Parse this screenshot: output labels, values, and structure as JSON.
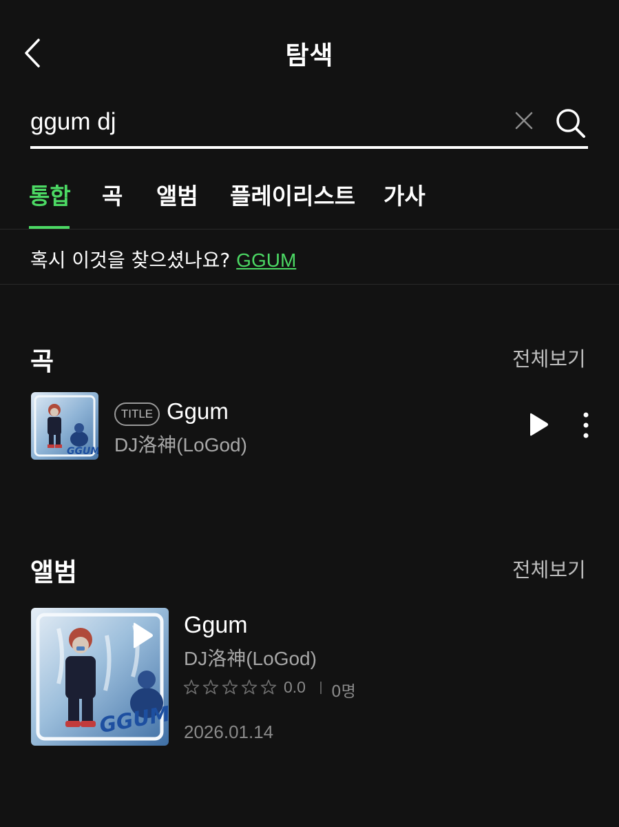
{
  "header": {
    "title": "탐색"
  },
  "search": {
    "query": "ggum dj"
  },
  "tabs": [
    {
      "label": "통합",
      "active": true
    },
    {
      "label": "곡",
      "active": false
    },
    {
      "label": "앨범",
      "active": false
    },
    {
      "label": "플레이리스트",
      "active": false
    },
    {
      "label": "가사",
      "active": false
    }
  ],
  "suggestion": {
    "prefix": "혹시 이것을 찾으셨나요?",
    "link": "GGUM"
  },
  "songs_section": {
    "title": "곡",
    "view_all": "전체보기",
    "items": [
      {
        "badge": "TITLE",
        "title": "Ggum",
        "artist": "DJ洛神(LoGod)"
      }
    ]
  },
  "albums_section": {
    "title": "앨범",
    "view_all": "전체보기",
    "items": [
      {
        "title": "Ggum",
        "artist": "DJ洛神(LoGod)",
        "rating": "0.0",
        "rating_stars": 0,
        "rating_count": "0명",
        "date": "2026.01.14"
      }
    ]
  },
  "colors": {
    "background": "#121212",
    "accent": "#4cd964",
    "secondary_text": "#a8a8a8"
  },
  "icons": [
    "back-chevron-icon",
    "clear-icon",
    "search-icon",
    "play-icon",
    "more-vertical-icon",
    "star-outline-icon"
  ]
}
